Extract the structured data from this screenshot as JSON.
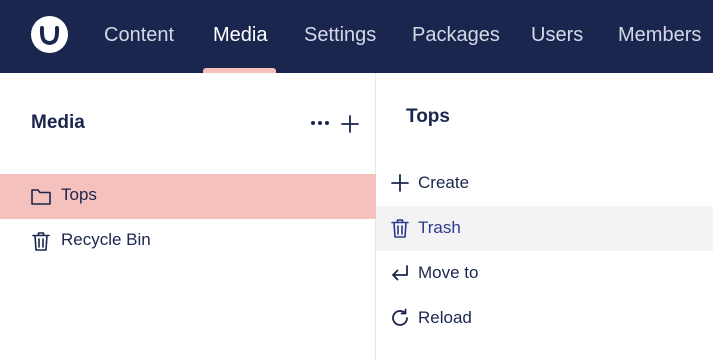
{
  "header": {
    "nav": [
      {
        "label": "Content",
        "active": false
      },
      {
        "label": "Media",
        "active": true
      },
      {
        "label": "Settings",
        "active": false
      },
      {
        "label": "Packages",
        "active": false
      },
      {
        "label": "Users",
        "active": false
      },
      {
        "label": "Members",
        "active": false
      }
    ],
    "logo_icon": "umbraco-logo-icon",
    "indicator_color": "#f5c1bc",
    "background_color": "#1b264f"
  },
  "tree": {
    "title": "Media",
    "menu_icon": "ellipsis-icon",
    "add_icon": "plus-icon",
    "items": [
      {
        "label": "Tops",
        "icon": "folder-icon",
        "selected": true
      },
      {
        "label": "Recycle Bin",
        "icon": "trash-icon",
        "selected": false
      }
    ],
    "selected_color": "#f5c1bc"
  },
  "actions_menu": {
    "title": "Tops",
    "items": [
      {
        "label": "Create",
        "icon": "plus-icon"
      },
      {
        "label": "Trash",
        "icon": "trash-icon",
        "highlighted": true
      },
      {
        "label": "Move to",
        "icon": "move-arrow-icon"
      },
      {
        "label": "Reload",
        "icon": "reload-icon"
      }
    ],
    "highlight_color": "#2f3a8a"
  }
}
